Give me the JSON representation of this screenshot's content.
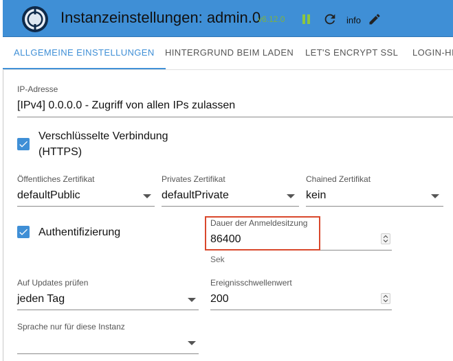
{
  "header": {
    "title": "Instanzeinstellungen: admin.0",
    "version": "v6.12.0",
    "info_label": "info"
  },
  "tabs": [
    {
      "label": "ALLGEMEINE EINSTELLUNGEN",
      "active": true
    },
    {
      "label": "HINTERGRUND BEIM LADEN",
      "active": false
    },
    {
      "label": "LET'S ENCRYPT SSL",
      "active": false
    },
    {
      "label": "LOGIN-HIN",
      "active": false
    }
  ],
  "ip": {
    "label": "IP-Adresse",
    "value": "[IPv4] 0.0.0.0 - Zugriff von allen IPs zulassen"
  },
  "https": {
    "label_line1": "Verschlüsselte Verbindung",
    "label_line2": "(HTTPS)",
    "checked": true
  },
  "certs": {
    "public": {
      "label": "Öffentliches Zertifikat",
      "value": "defaultPublic"
    },
    "private": {
      "label": "Privates Zertifikat",
      "value": "defaultPrivate"
    },
    "chained": {
      "label": "Chained Zertifikat",
      "value": "kein"
    }
  },
  "auth": {
    "label": "Authentifizierung",
    "checked": true
  },
  "session": {
    "label": "Dauer der Anmeldesitzung",
    "value": "86400",
    "helper": "Sek"
  },
  "updates": {
    "label": "Auf Updates prüfen",
    "value": "jeden Tag"
  },
  "threshold": {
    "label": "Ereignisschwellenwert",
    "value": "200"
  },
  "language": {
    "label": "Sprache nur für diese Instanz",
    "value": ""
  },
  "colors": {
    "accent": "#3f8fd6",
    "version_green": "#7fb33c",
    "highlight_red": "#d9472b"
  }
}
